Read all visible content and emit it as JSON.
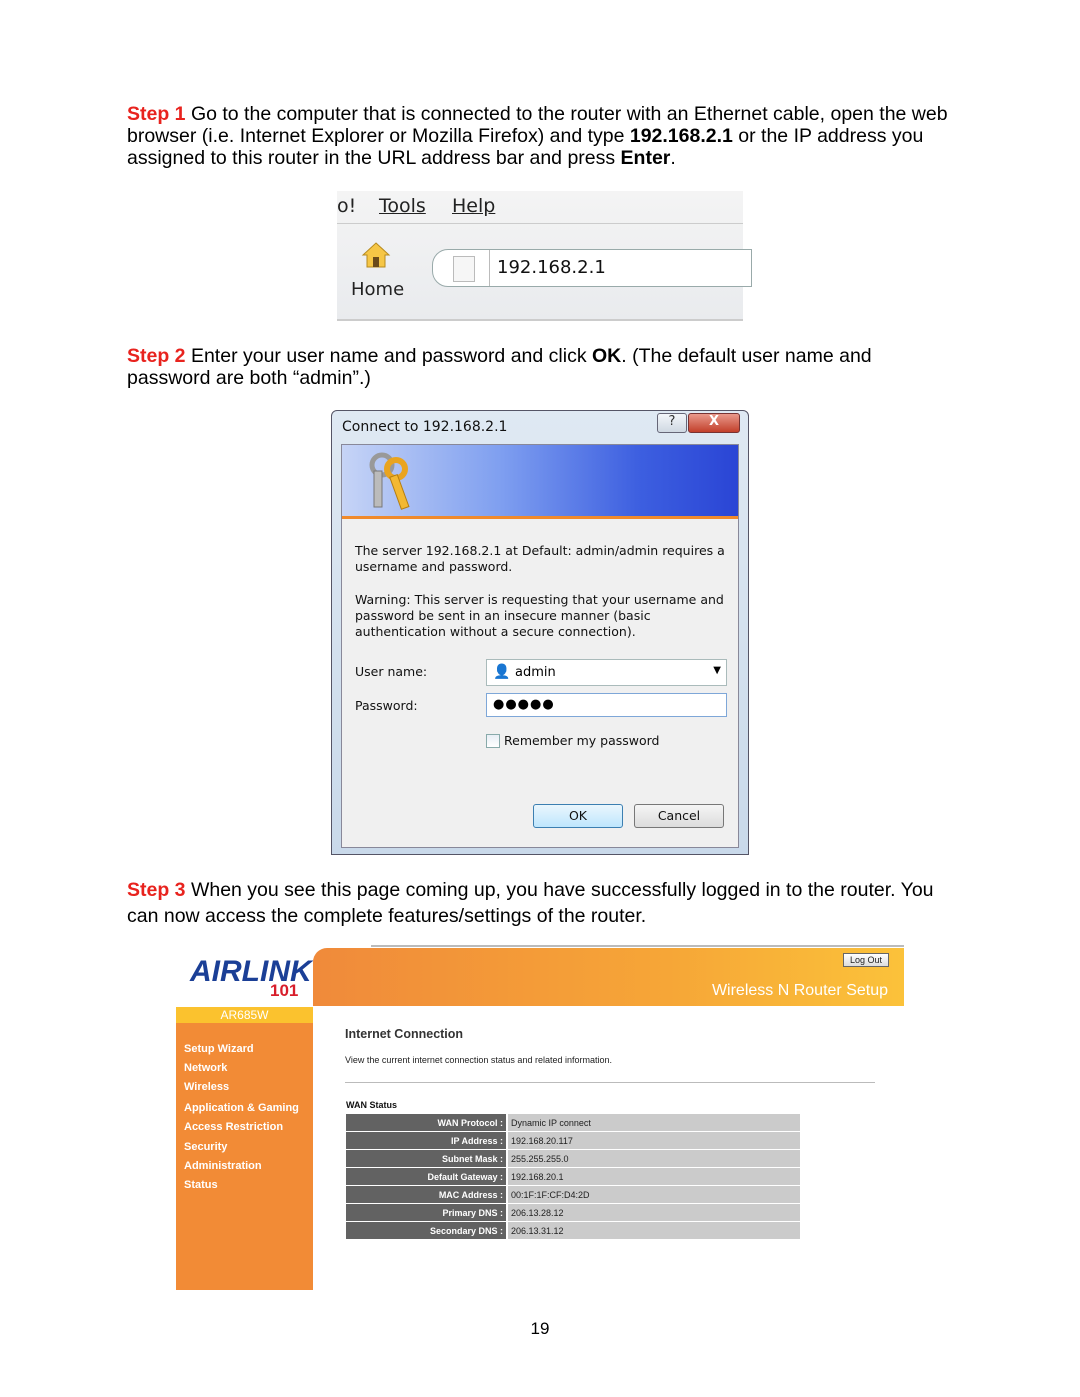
{
  "step1": {
    "label": "Step 1",
    "t1": " Go to the computer that is connected to the router with an Ethernet cable, open the web browser (i.e. Internet Explorer or Mozilla Firefox) and type ",
    "ip": "192.168.2.1",
    "t2": " or the IP address you assigned to this router in the URL address bar and press ",
    "enter": "Enter",
    "t3": "."
  },
  "browser": {
    "menu_partial": "o!",
    "menu_tools": "Tools",
    "menu_help": "Help",
    "home_label": "Home",
    "url": "192.168.2.1"
  },
  "step2": {
    "label": "Step 2",
    "t1": " Enter your user name and password and click ",
    "ok": "OK",
    "t2": ". (The default user name and password are both “admin”.)"
  },
  "dialog": {
    "title": "Connect to 192.168.2.1",
    "help": "?",
    "close": "X",
    "message": "The server 192.168.2.1 at Default: admin/admin requires a username and password.",
    "warning": "Warning: This server is requesting that your username and password be sent in an insecure manner (basic authentication without a secure connection).",
    "user_label": "User name:",
    "user_value": "admin",
    "password_label": "Password:",
    "password_value": "●●●●●",
    "remember_label": "Remember my password",
    "remember_checked": false,
    "ok": "OK",
    "cancel": "Cancel"
  },
  "step3": {
    "label": "Step 3",
    "text": " When you see this page coming up, you have successfully logged in to the router. You can now access the complete features/settings of the router."
  },
  "router": {
    "logo_text": "AIRLINK 101",
    "model": "AR685W",
    "logout": "Log Out",
    "header_title": "Wireless N Router Setup",
    "sidebar": [
      "Setup Wizard",
      "Network",
      "Wireless",
      "Application & Gaming",
      "Access Restriction",
      "Security",
      "Administration",
      "Status"
    ],
    "content_title": "Internet Connection",
    "content_desc": "View the current internet connection status and related information.",
    "wan_title": "WAN Status",
    "wan_rows": [
      {
        "k": "WAN Protocol :",
        "v": "Dynamic IP connect"
      },
      {
        "k": "IP Address :",
        "v": "192.168.20.117"
      },
      {
        "k": "Subnet Mask :",
        "v": "255.255.255.0"
      },
      {
        "k": "Default Gateway :",
        "v": "192.168.20.1"
      },
      {
        "k": "MAC Address :",
        "v": "00:1F:1F:CF:D4:2D"
      },
      {
        "k": "Primary DNS :",
        "v": "206.13.28.12"
      },
      {
        "k": "Secondary DNS :",
        "v": "206.13.31.12"
      }
    ],
    "colors": {
      "orange": "#f28b36",
      "yellow": "#fbc22e",
      "table_key": "#626262",
      "table_val": "#cbcbcb"
    }
  },
  "page_number": "19"
}
